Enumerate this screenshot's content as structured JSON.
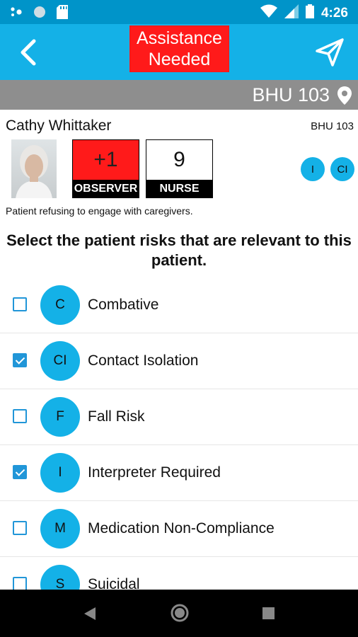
{
  "status_bar": {
    "time": "4:26"
  },
  "header": {
    "alert_line1": "Assistance",
    "alert_line2": "Needed",
    "back_icon": "back-arrow-icon",
    "send_icon": "send-icon"
  },
  "location": {
    "room": "BHU 103",
    "icon": "location-pin-icon"
  },
  "patient": {
    "name": "Cathy Whittaker",
    "room": "BHU 103",
    "observer_score": "+1",
    "observer_label": "OBSERVER",
    "nurse_score": "9",
    "nurse_label": "NURSE",
    "chips": [
      "I",
      "CI"
    ],
    "note": "Patient refusing to engage with caregivers."
  },
  "heading": "Select the patient risks that are relevant to this patient.",
  "risks": [
    {
      "abbr": "C",
      "label": "Combative",
      "checked": false
    },
    {
      "abbr": "CI",
      "label": "Contact Isolation",
      "checked": true
    },
    {
      "abbr": "F",
      "label": "Fall Risk",
      "checked": false
    },
    {
      "abbr": "I",
      "label": "Interpreter Required",
      "checked": true
    },
    {
      "abbr": "M",
      "label": "Medication Non-Compliance",
      "checked": false
    },
    {
      "abbr": "S",
      "label": "Suicidal",
      "checked": false
    }
  ],
  "colors": {
    "accent": "#14b1e7",
    "status": "#0094c9",
    "alert": "#ff1a1a",
    "checkbox": "#2196d8"
  }
}
